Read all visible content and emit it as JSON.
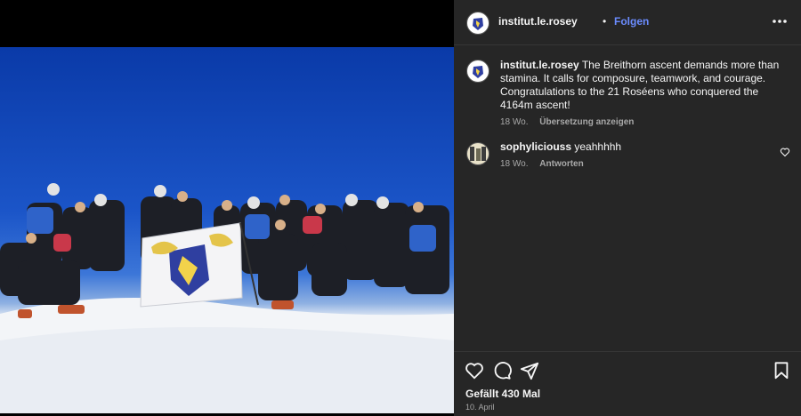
{
  "post": {
    "username": "institut.le.rosey",
    "separator": "•",
    "follow_label": "Folgen",
    "more_label": "•••"
  },
  "caption": {
    "username": "institut.le.rosey",
    "text": "The Breithorn ascent demands more than stamina. It calls for composure, teamwork, and courage. Congratulations to the 21 Roséens who conquered the 4164m ascent!",
    "time": "18 Wo.",
    "translate_label": "Übersetzung anzeigen"
  },
  "comments": [
    {
      "username": "sophyliciouss",
      "text": "yeahhhhh",
      "time": "18 Wo.",
      "reply_label": "Antworten"
    }
  ],
  "actions": {
    "icons": [
      "heart-icon",
      "comment-icon",
      "share-icon",
      "bookmark-icon"
    ]
  },
  "likes_label": "Gefällt 430 Mal",
  "date_label": "10. April",
  "colors": {
    "panel_bg": "#262626",
    "link_blue": "#6b8cff",
    "sky": "#1b55c8"
  }
}
